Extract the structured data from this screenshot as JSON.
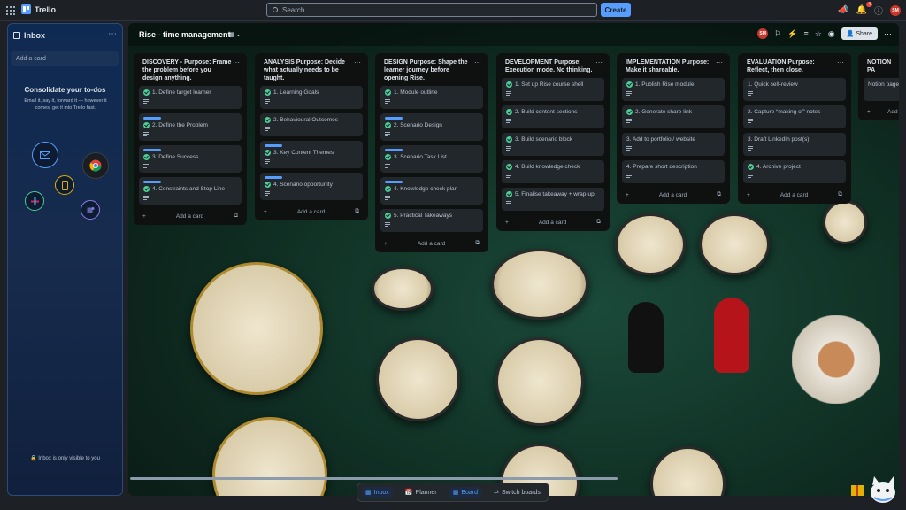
{
  "topbar": {
    "app_name": "Trello",
    "search_placeholder": "Search",
    "create_label": "Create",
    "notification_count": "4",
    "avatar_initials": "SM"
  },
  "inbox": {
    "title": "Inbox",
    "add_card_placeholder": "Add a card",
    "headline": "Consolidate your to-dos",
    "description": "Email it, say it, forward it — however it comes, get it into Trello fast.",
    "privacy_note": "Inbox is only visible to you"
  },
  "board": {
    "title": "Rise - time management",
    "share_label": "Share",
    "avatar_initials": "SM",
    "lists": [
      {
        "title": "DISCOVERY - Purpose: Frame the problem before you design anything.",
        "cards": [
          {
            "label": "1. Define target learner",
            "bar": false
          },
          {
            "label": "2. Define the Problem",
            "bar": true
          },
          {
            "label": "3. Define Success",
            "bar": true
          },
          {
            "label": "4. Constraints and Stop Line",
            "bar": true
          }
        ],
        "add_label": "Add a card"
      },
      {
        "title": "ANALYSIS Purpose: Decide what actually needs to be taught.",
        "cards": [
          {
            "label": "1. Learning Goals",
            "bar": false
          },
          {
            "label": "2. Behavioural Outcomes",
            "bar": false
          },
          {
            "label": "3. Key Content Themes",
            "bar": true
          },
          {
            "label": "4. Scenario opportunity",
            "bar": true
          }
        ],
        "add_label": "Add a card"
      },
      {
        "title": "DESIGN Purpose: Shape the learner journey before opening Rise.",
        "cards": [
          {
            "label": "1. Module outline",
            "bar": false
          },
          {
            "label": "2. Scenario Design",
            "bar": true
          },
          {
            "label": "3. Scenario Task List",
            "bar": true
          },
          {
            "label": "4. Knowledge check plan",
            "bar": true
          },
          {
            "label": "5. Practical Takeaways",
            "bar": false
          }
        ],
        "add_label": "Add a card"
      },
      {
        "title": "DEVELOPMENT Purpose: Execution mode. No thinking.",
        "cards": [
          {
            "label": "1. Set up Rise course shell",
            "bar": false
          },
          {
            "label": "2. Build content sections",
            "bar": false
          },
          {
            "label": "3. Build scenario block",
            "bar": false
          },
          {
            "label": "4. Build knowledge check",
            "bar": false
          },
          {
            "label": "5. Finalise takeaway + wrap-up",
            "bar": false
          }
        ],
        "add_label": "Add a card"
      },
      {
        "title": "IMPLEMENTATION Purpose: Make it shareable.",
        "cards": [
          {
            "label": "1. Publish Rise module",
            "bar": false
          },
          {
            "label": "2. Generate share link",
            "bar": false
          },
          {
            "label": "3. Add to portfolio / website",
            "bar": false,
            "nocheck": true
          },
          {
            "label": "4. Prepare short description",
            "bar": false,
            "nocheck": true
          }
        ],
        "add_label": "Add a card"
      },
      {
        "title": "EVALUATION Purpose: Reflect, then close.",
        "cards": [
          {
            "label": "1. Quick self-review",
            "bar": false,
            "nocheck": true
          },
          {
            "label": "2. Capture “making of” notes",
            "bar": false,
            "nocheck": true
          },
          {
            "label": "3. Draft LinkedIn post(s)",
            "bar": false,
            "nocheck": true
          },
          {
            "label": "4. Archive project",
            "bar": false
          }
        ],
        "add_label": "Add a card"
      },
      {
        "title": "NOTION PA",
        "cards": [
          {
            "label": "Notion page",
            "bar": false,
            "nocheck": true
          }
        ],
        "add_label": "Add a"
      }
    ]
  },
  "bottom_nav": {
    "inbox": "Inbox",
    "planner": "Planner",
    "board": "Board",
    "switch": "Switch boards"
  },
  "colors": {
    "accent": "#579dff",
    "check": "#4bce97",
    "notification": "#e2483d"
  }
}
